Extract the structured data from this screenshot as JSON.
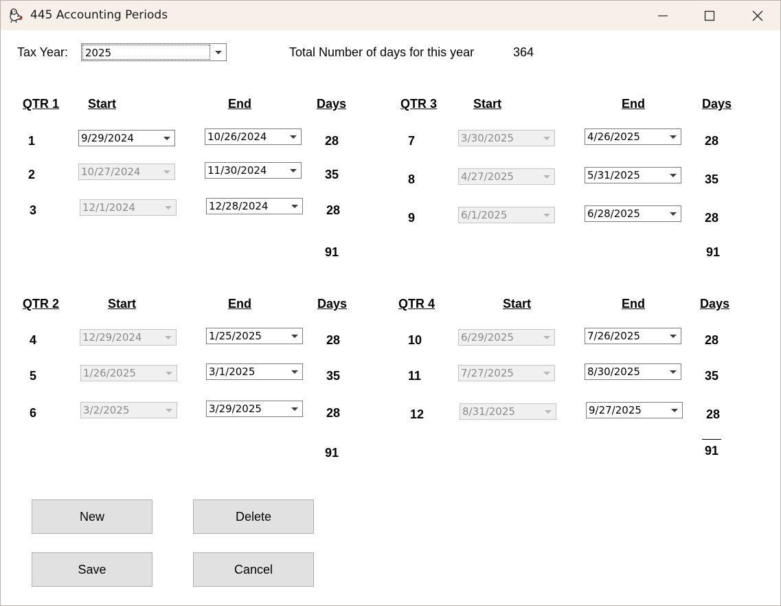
{
  "window": {
    "title": "445 Accounting Periods",
    "icon": "dog-app-icon"
  },
  "header": {
    "tax_year_label": "Tax Year:",
    "tax_year_value": "2025",
    "total_days_label": "Total Number of days for this year",
    "total_days_value": "364"
  },
  "quarters": [
    {
      "label": "QTR 1",
      "start_header": "Start",
      "end_header": "End",
      "days_header": "Days",
      "periods": [
        {
          "num": "1",
          "start": "9/29/2024",
          "start_enabled": true,
          "end": "10/26/2024",
          "days": "28"
        },
        {
          "num": "2",
          "start": "10/27/2024",
          "start_enabled": false,
          "end": "11/30/2024",
          "days": "35"
        },
        {
          "num": "3",
          "start": "12/1/2024",
          "start_enabled": false,
          "end": "12/28/2024",
          "days": "28"
        }
      ],
      "total": "91"
    },
    {
      "label": "QTR 2",
      "start_header": "Start",
      "end_header": "End",
      "days_header": "Days",
      "periods": [
        {
          "num": "4",
          "start": "12/29/2024",
          "start_enabled": false,
          "end": "1/25/2025",
          "days": "28"
        },
        {
          "num": "5",
          "start": "1/26/2025",
          "start_enabled": false,
          "end": "3/1/2025",
          "days": "35"
        },
        {
          "num": "6",
          "start": "3/2/2025",
          "start_enabled": false,
          "end": "3/29/2025",
          "days": "28"
        }
      ],
      "total": "91"
    },
    {
      "label": "QTR 3",
      "start_header": "Start",
      "end_header": "End",
      "days_header": "Days",
      "periods": [
        {
          "num": "7",
          "start": "3/30/2025",
          "start_enabled": false,
          "end": "4/26/2025",
          "days": "28"
        },
        {
          "num": "8",
          "start": "4/27/2025",
          "start_enabled": false,
          "end": "5/31/2025",
          "days": "35"
        },
        {
          "num": "9",
          "start": "6/1/2025",
          "start_enabled": false,
          "end": "6/28/2025",
          "days": "28"
        }
      ],
      "total": "91"
    },
    {
      "label": "QTR 4",
      "start_header": "Start",
      "end_header": "End",
      "days_header": "Days",
      "periods": [
        {
          "num": "10",
          "start": "6/29/2025",
          "start_enabled": false,
          "end": "7/26/2025",
          "days": "28"
        },
        {
          "num": "11",
          "start": "7/27/2025",
          "start_enabled": false,
          "end": "8/30/2025",
          "days": "35"
        },
        {
          "num": "12",
          "start": "8/31/2025",
          "start_enabled": false,
          "end": "9/27/2025",
          "days": "28"
        }
      ],
      "total": "91"
    }
  ],
  "buttons": {
    "new": "New",
    "delete": "Delete",
    "save": "Save",
    "cancel": "Cancel"
  }
}
